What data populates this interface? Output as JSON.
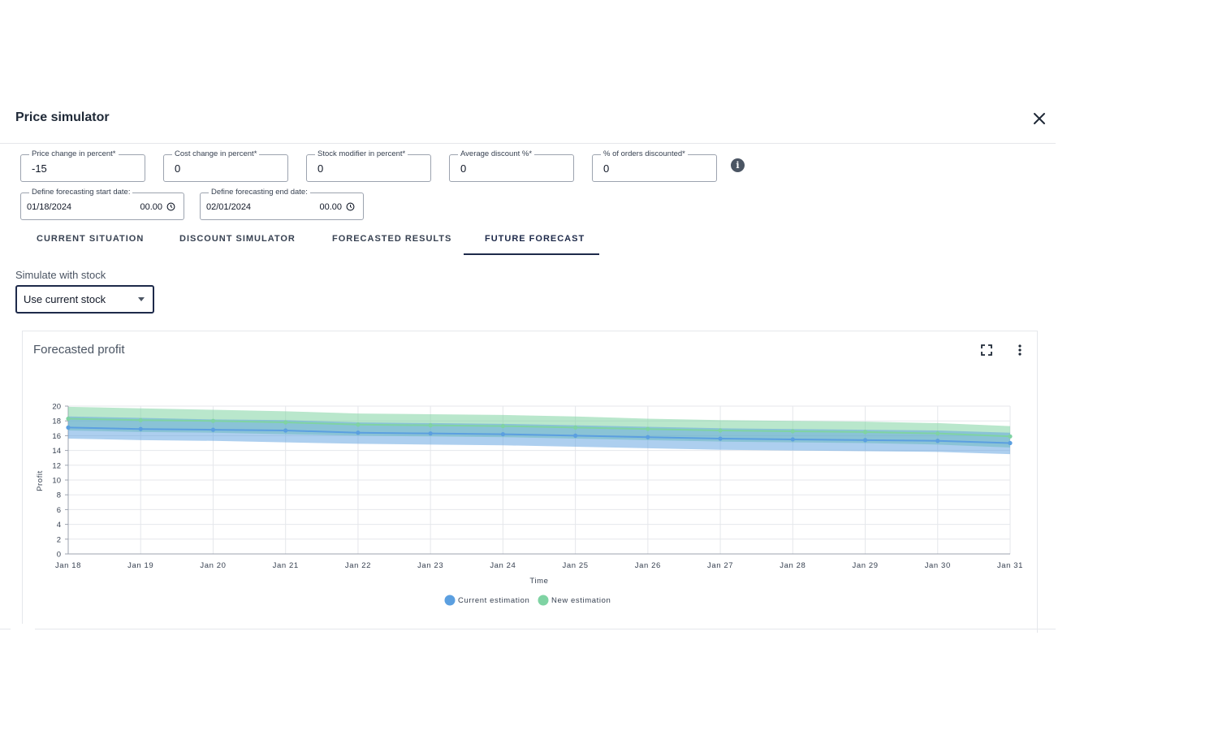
{
  "dialog": {
    "title": "Price simulator"
  },
  "inputs": [
    {
      "label": "Price change in percent*",
      "value": "-15"
    },
    {
      "label": "Cost change in percent*",
      "value": "0"
    },
    {
      "label": "Stock modifier in percent*",
      "value": "0"
    },
    {
      "label": "Average discount %*",
      "value": "0"
    },
    {
      "label": "% of orders discounted*",
      "value": "0"
    }
  ],
  "dates": {
    "start": {
      "label": "Define forecasting start date:",
      "date": "01/18/2024",
      "time": "00.00"
    },
    "end": {
      "label": "Define forecasting end date:",
      "date": "02/01/2024",
      "time": "00.00"
    }
  },
  "info_icon": "i",
  "tabs": [
    {
      "label": "CURRENT SITUATION",
      "active": false
    },
    {
      "label": "DISCOUNT SIMULATOR",
      "active": false
    },
    {
      "label": "FORECASTED RESULTS",
      "active": false
    },
    {
      "label": "FUTURE FORECAST",
      "active": true
    }
  ],
  "stock": {
    "label": "Simulate with stock",
    "selected": "Use current stock"
  },
  "icons": {
    "close": "close-icon",
    "clock": "clock-icon",
    "info": "info-icon",
    "expand": "fullscreen-icon",
    "more": "more-vert-icon",
    "caret": "caret-down-icon"
  },
  "colors": {
    "accent": "#1e2a4a",
    "current": "#5b9fe0",
    "new": "#7fd3a3"
  },
  "chart_data": {
    "type": "line",
    "title": "Forecasted profit",
    "xlabel": "Time",
    "ylabel": "Profit",
    "categories": [
      "Jan 18",
      "Jan 19",
      "Jan 20",
      "Jan 21",
      "Jan 22",
      "Jan 23",
      "Jan 24",
      "Jan 25",
      "Jan 26",
      "Jan 27",
      "Jan 28",
      "Jan 29",
      "Jan 30",
      "Jan 31"
    ],
    "ylim": [
      0,
      20
    ],
    "yticks": [
      0,
      2,
      4,
      6,
      8,
      10,
      12,
      14,
      16,
      18,
      20
    ],
    "grid": true,
    "legend_position": "bottom-center",
    "series": [
      {
        "name": "Current estimation",
        "color": "#5b9fe0",
        "values": [
          17.1,
          16.9,
          16.8,
          16.7,
          16.4,
          16.3,
          16.2,
          16.0,
          15.8,
          15.6,
          15.5,
          15.4,
          15.3,
          15.0
        ],
        "lower": [
          15.6,
          15.4,
          15.3,
          15.1,
          14.9,
          14.8,
          14.7,
          14.5,
          14.3,
          14.1,
          14.0,
          13.9,
          13.8,
          13.5
        ],
        "upper": [
          18.6,
          18.4,
          18.2,
          18.1,
          17.8,
          17.7,
          17.6,
          17.4,
          17.2,
          17.0,
          16.9,
          16.8,
          16.7,
          16.4
        ]
      },
      {
        "name": "New estimation",
        "color": "#7fd3a3",
        "values": [
          18.3,
          18.1,
          18.0,
          17.8,
          17.5,
          17.4,
          17.3,
          17.1,
          16.9,
          16.7,
          16.6,
          16.5,
          16.3,
          15.9
        ],
        "lower": [
          16.7,
          16.5,
          16.4,
          16.2,
          16.0,
          15.9,
          15.8,
          15.6,
          15.4,
          15.2,
          15.1,
          15.0,
          14.8,
          14.4
        ],
        "upper": [
          19.9,
          19.7,
          19.5,
          19.3,
          19.0,
          18.9,
          18.8,
          18.6,
          18.3,
          18.1,
          18.0,
          17.9,
          17.7,
          17.3
        ]
      }
    ]
  }
}
